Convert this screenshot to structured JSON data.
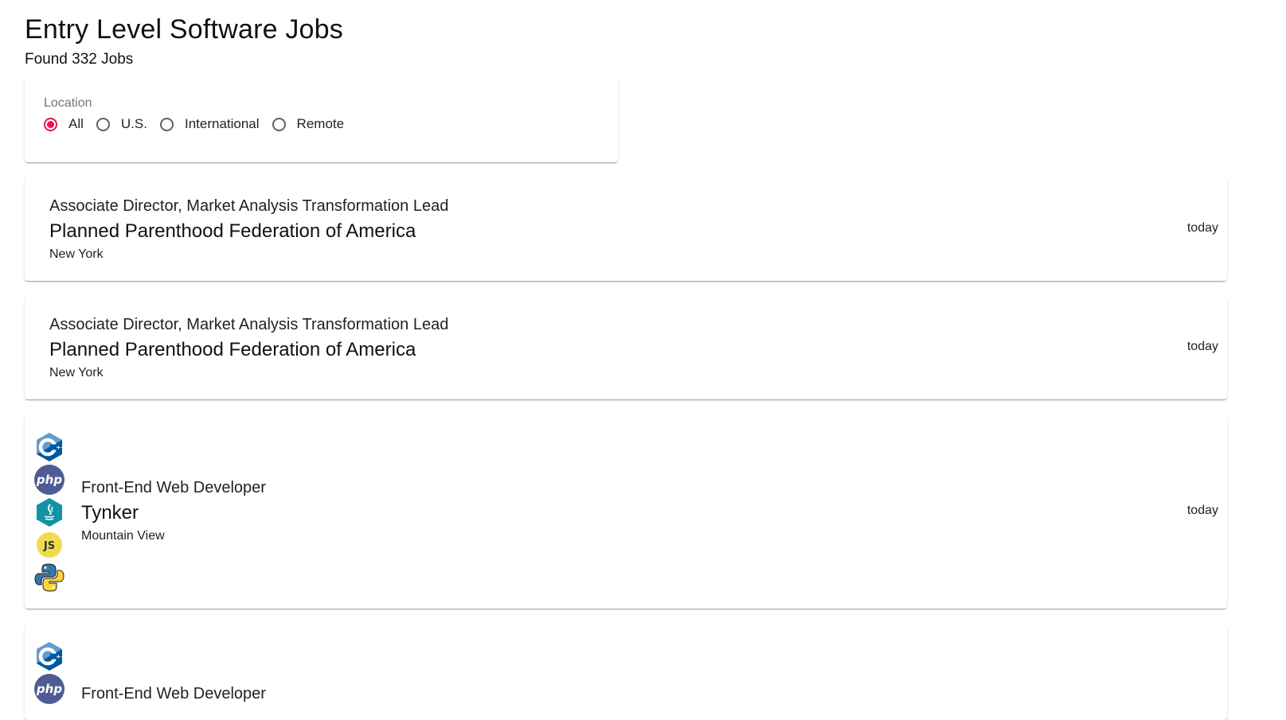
{
  "header": {
    "title": "Entry Level Software Jobs",
    "count": "Found 332 Jobs"
  },
  "filter": {
    "label": "Location",
    "options": [
      {
        "label": "All",
        "selected": true
      },
      {
        "label": "U.S.",
        "selected": false
      },
      {
        "label": "International",
        "selected": false
      },
      {
        "label": "Remote",
        "selected": false
      }
    ]
  },
  "jobs": [
    {
      "title": "Associate Director, Market Analysis Transformation Lead",
      "company": "Planned Parenthood Federation of America",
      "location": "New York",
      "posted": "today",
      "tech_icons": []
    },
    {
      "title": "Associate Director, Market Analysis Transformation Lead",
      "company": "Planned Parenthood Federation of America",
      "location": "New York",
      "posted": "today",
      "tech_icons": []
    },
    {
      "title": "Front-End Web Developer",
      "company": "Tynker",
      "location": "Mountain View",
      "posted": "today",
      "tech_icons": [
        "cpp-icon",
        "php-icon",
        "java-icon",
        "javascript-icon",
        "python-icon"
      ]
    },
    {
      "title": "Front-End Web Developer",
      "tech_icons": [
        "cpp-icon",
        "php-icon"
      ]
    }
  ],
  "colors": {
    "accent": "#e8174f",
    "cpp": "#00599c",
    "php": "#4f5b93",
    "java": "#1391a6",
    "javascript": "#f0db4f",
    "python_blue": "#3776ab",
    "python_yellow": "#ffd43b"
  }
}
